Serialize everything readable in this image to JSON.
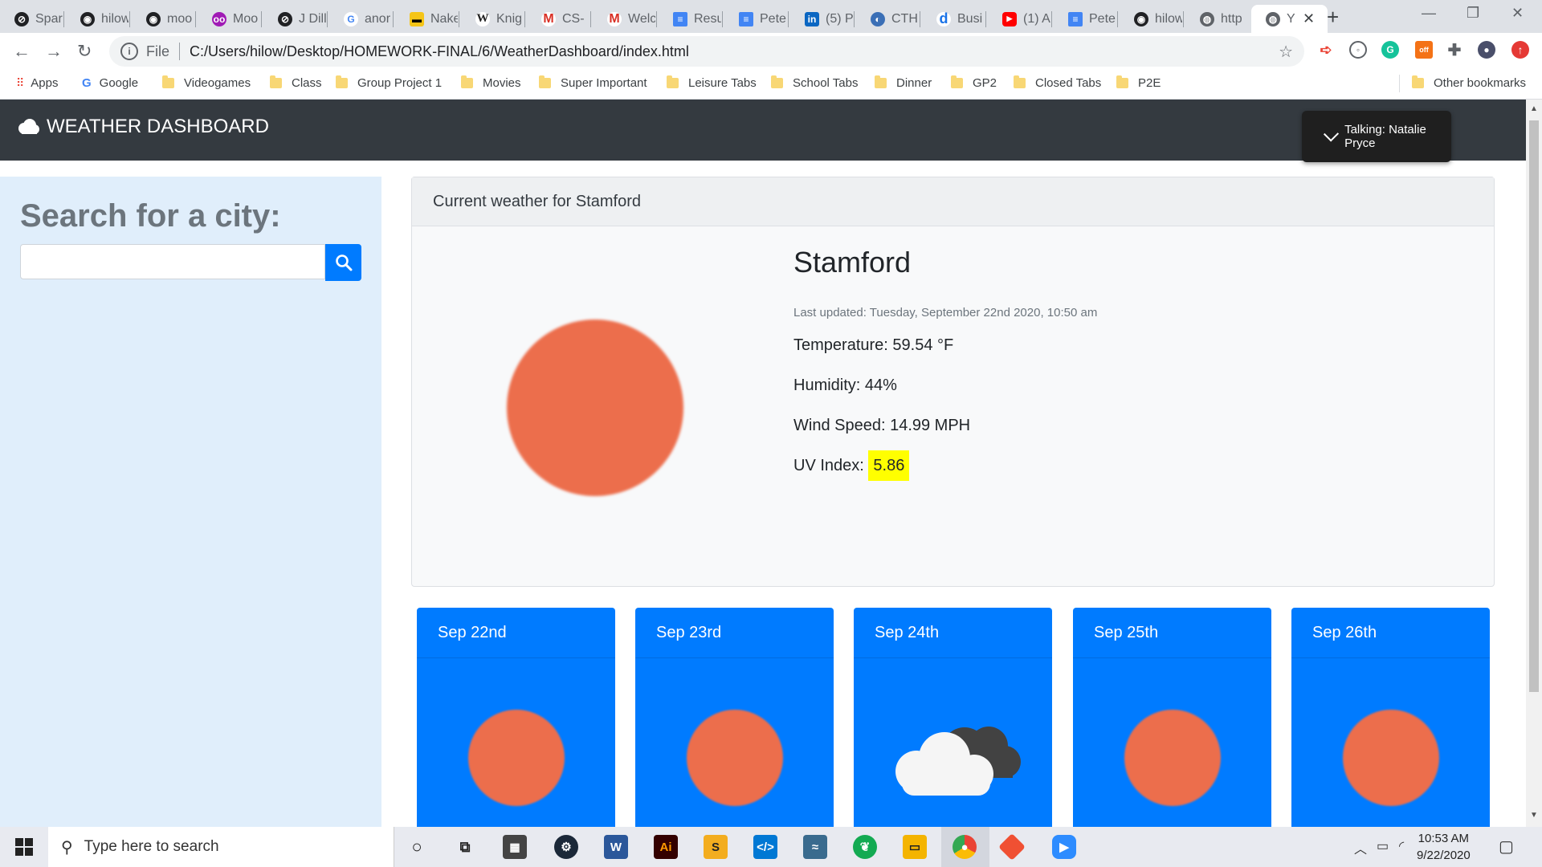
{
  "browser": {
    "tabs": [
      {
        "label": "Spar",
        "icon": "circle-slash-icon",
        "color": "#202124"
      },
      {
        "label": "hilow",
        "icon": "github-icon",
        "color": "#202124"
      },
      {
        "label": "moo",
        "icon": "github-icon",
        "color": "#202124"
      },
      {
        "label": "Moo",
        "icon": "owl-icon",
        "color": "#a01ab5"
      },
      {
        "label": "J Dill",
        "icon": "circle-slash-icon",
        "color": "#202124"
      },
      {
        "label": "anor",
        "icon": "google-icon",
        "color": "#4285f4"
      },
      {
        "label": "Nake",
        "icon": "imdb-icon",
        "color": "#f5c518"
      },
      {
        "label": "Knig",
        "icon": "wikipedia-icon",
        "color": "#555555"
      },
      {
        "label": "CS-",
        "icon": "gmail-icon",
        "color": "#d93025"
      },
      {
        "label": "Welc",
        "icon": "gmail-icon",
        "color": "#d93025"
      },
      {
        "label": "Resu",
        "icon": "docs-icon",
        "color": "#4285f4"
      },
      {
        "label": "Pete",
        "icon": "docs-icon",
        "color": "#4285f4"
      },
      {
        "label": "(5) P",
        "icon": "linkedin-icon",
        "color": "#0a66c2"
      },
      {
        "label": "CTH",
        "icon": "globe-icon",
        "color": "#3b6fb6"
      },
      {
        "label": "Busi",
        "icon": "dictionary-icon",
        "color": "#1a73e8"
      },
      {
        "label": "(1) A",
        "icon": "youtube-icon",
        "color": "#ff0000"
      },
      {
        "label": "Pete",
        "icon": "docs-icon",
        "color": "#4285f4"
      },
      {
        "label": "hilow",
        "icon": "github-icon",
        "color": "#202124"
      },
      {
        "label": "http",
        "icon": "globe-icon",
        "color": "#5f6368"
      }
    ],
    "active_tab": {
      "label": "Y",
      "icon": "globe-icon"
    },
    "address": {
      "scheme": "File",
      "url": "C:/Users/hilow/Desktop/HOMEWORK-FINAL/6/WeatherDashboard/index.html"
    },
    "bookmarks": [
      {
        "label": "Apps",
        "icon": "apps-grid-icon"
      },
      {
        "label": "Google",
        "icon": "google-icon"
      },
      {
        "label": "Videogames",
        "icon": "folder-icon"
      },
      {
        "label": "Class",
        "icon": "folder-icon"
      },
      {
        "label": "Group Project 1",
        "icon": "folder-icon"
      },
      {
        "label": "Movies",
        "icon": "folder-icon"
      },
      {
        "label": "Super Important",
        "icon": "folder-icon"
      },
      {
        "label": "Leisure Tabs",
        "icon": "folder-icon"
      },
      {
        "label": "School Tabs",
        "icon": "folder-icon"
      },
      {
        "label": "Dinner",
        "icon": "folder-icon"
      },
      {
        "label": "GP2",
        "icon": "folder-icon"
      },
      {
        "label": "Closed Tabs",
        "icon": "folder-icon"
      },
      {
        "label": "P2E",
        "icon": "folder-icon"
      }
    ],
    "other_bookmarks": "Other bookmarks"
  },
  "app": {
    "brand": "WEATHER DASHBOARD",
    "toast": "Talking: Natalie Pryce",
    "search": {
      "heading": "Search for a city:",
      "placeholder": ""
    },
    "current": {
      "header": "Current weather for Stamford",
      "city": "Stamford",
      "last_updated": "Last updated: Tuesday, September 22nd 2020, 10:50 am",
      "temperature": "Temperature: 59.54 °F",
      "humidity": "Humidity: 44%",
      "wind": "Wind Speed: 14.99 MPH",
      "uv_label": "UV Index:",
      "uv_value": "5.86",
      "icon": "sun-icon"
    },
    "forecast": [
      {
        "date": "Sep 22nd",
        "icon": "sun-icon"
      },
      {
        "date": "Sep 23rd",
        "icon": "sun-icon"
      },
      {
        "date": "Sep 24th",
        "icon": "cloudy-icon"
      },
      {
        "date": "Sep 25th",
        "icon": "sun-icon"
      },
      {
        "date": "Sep 26th",
        "icon": "sun-icon"
      }
    ],
    "colors": {
      "navbar": "#343a40",
      "primary": "#007bff",
      "sun": "#ec6e4c",
      "uv_highlight": "#ffff00",
      "sidebar": "#e0eefb"
    }
  },
  "taskbar": {
    "search_placeholder": "Type here to search",
    "time": "10:53 AM",
    "date": "9/22/2020"
  }
}
